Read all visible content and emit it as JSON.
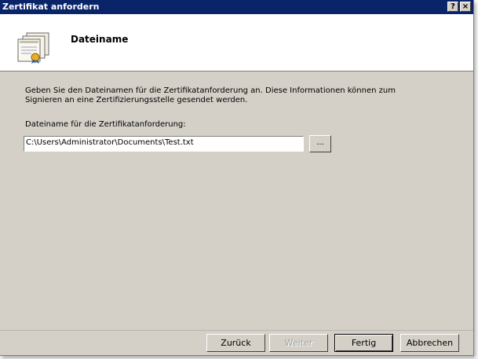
{
  "window": {
    "title": "Zertifikat anfordern"
  },
  "titlebar_buttons": {
    "help": "?",
    "close": "×"
  },
  "header": {
    "title": "Dateiname"
  },
  "content": {
    "description_line1": "Geben Sie den Dateinamen für die Zertifikatanforderung an. Diese Informationen können zum",
    "description_line2": "Signieren an eine Zertifizierungsstelle gesendet werden.",
    "field_label": "Dateiname für die Zertifikatanforderung:",
    "filename_value": "C:\\Users\\Administrator\\Documents\\Test.txt",
    "browse_label": "..."
  },
  "buttons": {
    "back": "Zurück",
    "next": "Weiter",
    "finish": "Fertig",
    "cancel": "Abbrechen"
  },
  "icons": {
    "header_icon": "certificate-icon"
  },
  "colors": {
    "titlebar": "#0a246a",
    "dialog_bg": "#d4d0c8"
  }
}
